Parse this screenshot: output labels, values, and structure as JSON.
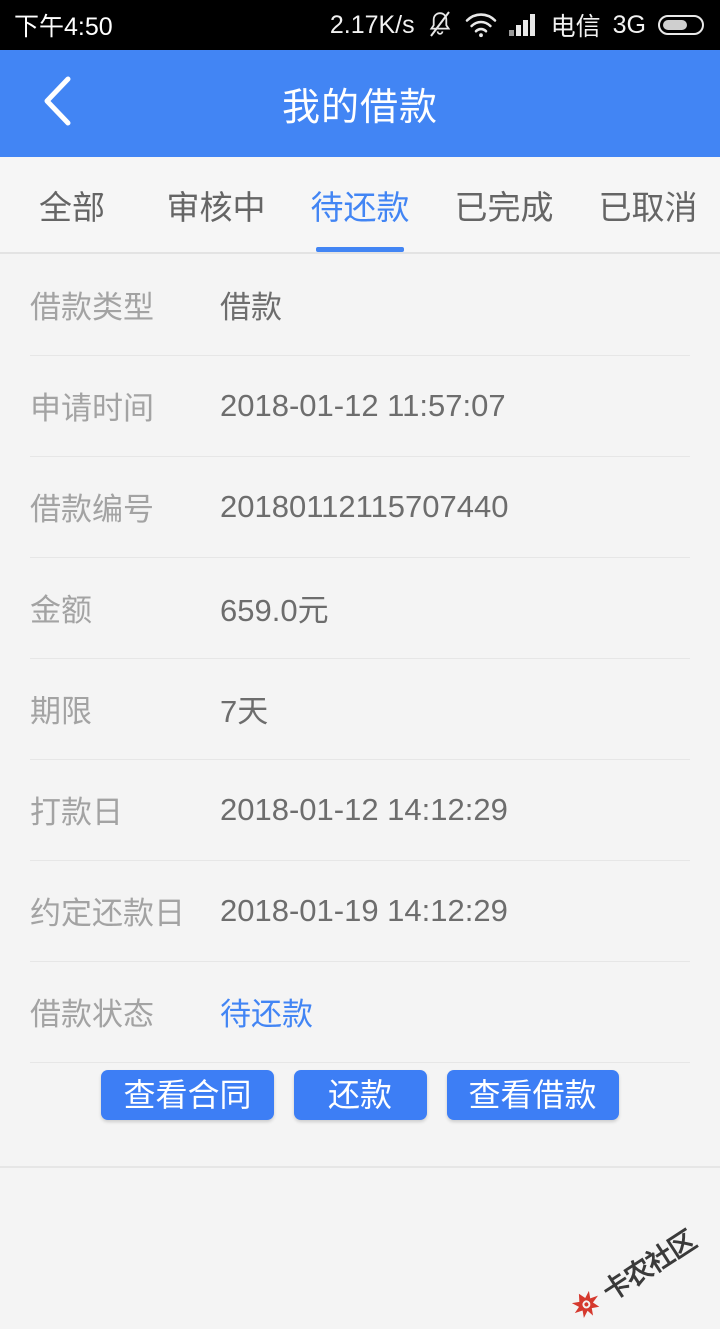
{
  "status_bar": {
    "time": "下午4:50",
    "network_speed": "2.17K/s",
    "carrier": "电信",
    "network_type": "3G",
    "icons": [
      "bell-muted-icon",
      "wifi-icon",
      "signal-icon",
      "battery-icon"
    ]
  },
  "header": {
    "title": "我的借款",
    "back_icon": "chevron-left-icon",
    "background_color": "#4285f4"
  },
  "tabs": {
    "items": [
      {
        "label": "全部",
        "active": false
      },
      {
        "label": "审核中",
        "active": false
      },
      {
        "label": "待还款",
        "active": true
      },
      {
        "label": "已完成",
        "active": false
      },
      {
        "label": "已取消",
        "active": false
      }
    ],
    "active_color": "#4285f4",
    "inactive_color": "#656565"
  },
  "detail": {
    "rows": [
      {
        "label": "借款类型",
        "value": "借款",
        "accent": false
      },
      {
        "label": "申请时间",
        "value": "2018-01-12 11:57:07",
        "accent": false
      },
      {
        "label": "借款编号",
        "value": "20180112115707440",
        "accent": false
      },
      {
        "label": "金额",
        "value": "659.0元",
        "accent": false
      },
      {
        "label": "期限",
        "value": "7天",
        "accent": false
      },
      {
        "label": "打款日",
        "value": "2018-01-12 14:12:29",
        "accent": false
      },
      {
        "label": "约定还款日",
        "value": "2018-01-19 14:12:29",
        "accent": false
      },
      {
        "label": "借款状态",
        "value": "待还款",
        "accent": true
      }
    ]
  },
  "actions": {
    "buttons": [
      {
        "label": "查看合同"
      },
      {
        "label": "还款"
      },
      {
        "label": "查看借款"
      }
    ],
    "button_color": "#3d7ef5"
  },
  "watermark": {
    "text": "卡农社区",
    "logo_color": "#d32a1e"
  }
}
